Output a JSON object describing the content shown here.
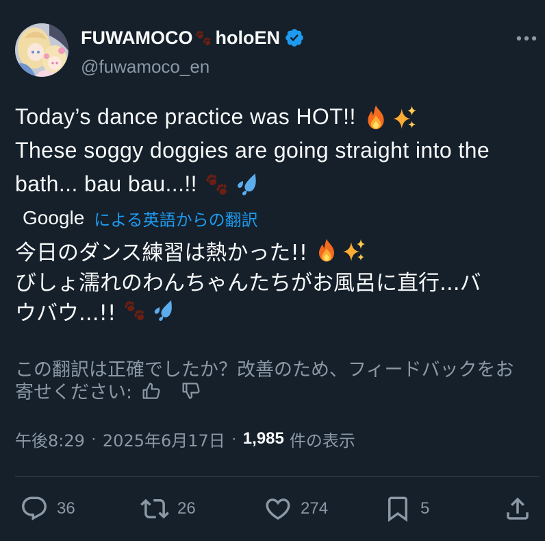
{
  "colors": {
    "background": "#15202b",
    "text": "#f7f9f9",
    "muted": "#8b98a5",
    "accent": "#1d9bf0",
    "divider": "#38444d"
  },
  "author": {
    "name_before_emoji": "FUWAMOCO",
    "name_emoji": "paw-prints",
    "name_after_emoji": "holoEN",
    "verified_icon": "verified-badge-icon",
    "handle": "@fuwamoco_en"
  },
  "more_icon": "more-icon",
  "tweet": {
    "lines": [
      {
        "text": "Today’s dance practice was HOT!!",
        "emoji": [
          "fire",
          "sparkles"
        ]
      },
      {
        "text": "These soggy doggies are going straight into the",
        "emoji": []
      },
      {
        "text": "bath... bau bau...!!",
        "emoji": [
          "paw-prints",
          "sweat-droplets"
        ]
      }
    ]
  },
  "translation": {
    "provider": "Google",
    "label": "による英語からの翻訳",
    "lines": [
      {
        "text": "今日のダンス練習は熱かった!!",
        "emoji": [
          "fire",
          "sparkles"
        ]
      },
      {
        "text": "びしょ濡れのわんちゃんたちがお風呂に直行...バ",
        "emoji": []
      },
      {
        "text": "ウバウ...!!",
        "emoji": [
          "paw-prints",
          "sweat-droplets"
        ]
      }
    ],
    "feedback": {
      "line1": "この翻訳は正確でしたか？改善のため、フィードバックをお",
      "line2": "寄せください:",
      "icons": [
        "thumbs-up-icon",
        "thumbs-down-icon"
      ]
    }
  },
  "meta": {
    "time": "午後8:29",
    "separator": "·",
    "date": "2025年6月17日",
    "views_count": "1,985",
    "views_label": "件の表示"
  },
  "actions": {
    "reply": {
      "icon": "reply-icon",
      "count": "36"
    },
    "repost": {
      "icon": "repost-icon",
      "count": "26"
    },
    "like": {
      "icon": "like-icon",
      "count": "274"
    },
    "bookmark": {
      "icon": "bookmark-icon",
      "count": "5"
    },
    "share": {
      "icon": "share-icon"
    }
  }
}
